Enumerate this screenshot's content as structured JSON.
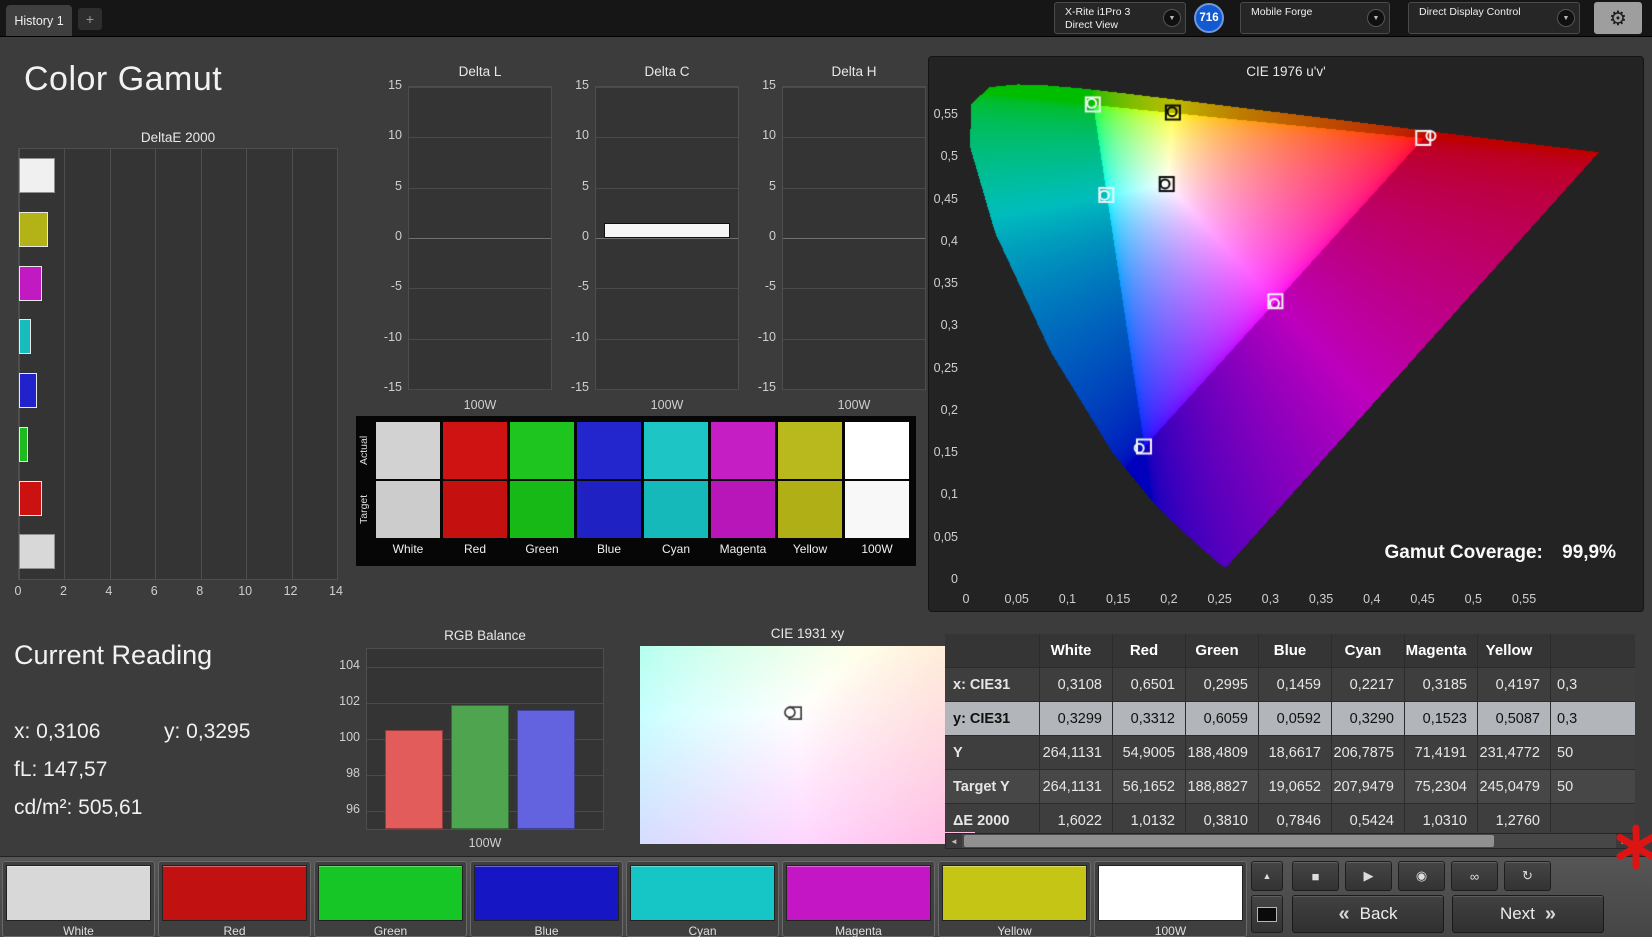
{
  "top_bar": {
    "tab": "History 1",
    "new_tab": "+",
    "meter_line1": "X-Rite i1Pro 3",
    "meter_line2": "Direct View",
    "meter_accent": "#3fd43f",
    "badge": "716",
    "source": "Mobile Forge",
    "source_accent": "#e8e81a",
    "display_control": "Direct Display Control",
    "display_accent": "#d6e81a",
    "gear_glyph": "⚙",
    "chevron_glyph": "▼"
  },
  "page": {
    "title": "Color Gamut"
  },
  "current_reading": {
    "title": "Current Reading",
    "line_x": "x: 0,3106",
    "line_y": "y: 0,3295",
    "line_fl": "fL: 147,57",
    "line_cd": "cd/m²: 505,61"
  },
  "gamut_coverage": {
    "label": "Gamut Coverage:",
    "value": "99,9%"
  },
  "swatch_grid": {
    "row_labels": [
      "Actual",
      "Target"
    ],
    "columns": [
      {
        "name": "White",
        "actual": "#d2d2d2",
        "target": "#cccccc"
      },
      {
        "name": "Red",
        "actual": "#cf1212",
        "target": "#c51010"
      },
      {
        "name": "Green",
        "actual": "#1ec51e",
        "target": "#16b916"
      },
      {
        "name": "Blue",
        "actual": "#2326cd",
        "target": "#1f21c2"
      },
      {
        "name": "Cyan",
        "actual": "#1ec5c5",
        "target": "#16b9b9"
      },
      {
        "name": "Magenta",
        "actual": "#c51ec5",
        "target": "#b916b9"
      },
      {
        "name": "Yellow",
        "actual": "#b9b91e",
        "target": "#b0b016"
      },
      {
        "name": "100W",
        "actual": "#ffffff",
        "target": "#f8f8f8"
      }
    ]
  },
  "table": {
    "headers": [
      "",
      "White",
      "Red",
      "Green",
      "Blue",
      "Cyan",
      "Magenta",
      "Yellow",
      ""
    ],
    "selected_index": 1,
    "rows": [
      {
        "label": "x: CIE31",
        "values": [
          "0,3108",
          "0,6501",
          "0,2995",
          "0,1459",
          "0,2217",
          "0,3185",
          "0,4197"
        ],
        "partial": "0,3"
      },
      {
        "label": "y: CIE31",
        "values": [
          "0,3299",
          "0,3312",
          "0,6059",
          "0,0592",
          "0,3290",
          "0,1523",
          "0,5087"
        ],
        "partial": "0,3"
      },
      {
        "label": "Y",
        "values": [
          "264,1131",
          "54,9005",
          "188,4809",
          "18,6617",
          "206,7875",
          "71,4191",
          "231,4772"
        ],
        "partial": "50"
      },
      {
        "label": "Target Y",
        "values": [
          "264,1131",
          "56,1652",
          "188,8827",
          "19,0652",
          "207,9479",
          "75,2304",
          "245,0479"
        ],
        "partial": "50"
      },
      {
        "label": "ΔE 2000",
        "values": [
          "1,6022",
          "1,0132",
          "0,3810",
          "0,7846",
          "0,5424",
          "1,0310",
          "1,2760"
        ],
        "partial": ""
      }
    ]
  },
  "scrollbar": {
    "left_arrow": "◄",
    "right_arrow": "►"
  },
  "bottom_bar": {
    "swatches": [
      {
        "label": "White",
        "color": "#d8d8d8"
      },
      {
        "label": "Red",
        "color": "#c21111"
      },
      {
        "label": "Green",
        "color": "#16c526"
      },
      {
        "label": "Blue",
        "color": "#1616c5"
      },
      {
        "label": "Cyan",
        "color": "#16c5c5"
      },
      {
        "label": "Magenta",
        "color": "#c516c5"
      },
      {
        "label": "Yellow",
        "color": "#c5c516"
      },
      {
        "label": "100W",
        "color": "#ffffff"
      }
    ],
    "up_glyph": "▲",
    "transport": [
      {
        "name": "stop-button",
        "icon": "stop-icon",
        "glyph": "■"
      },
      {
        "name": "play-button",
        "icon": "play-icon",
        "glyph": "▶"
      },
      {
        "name": "read-single-button",
        "icon": "read-single-icon",
        "glyph": "◉"
      },
      {
        "name": "link-button",
        "icon": "link-icon",
        "glyph": "∞"
      },
      {
        "name": "refresh-button",
        "icon": "refresh-icon",
        "glyph": "↻"
      }
    ],
    "back_chevron": "«",
    "back_label": "Back",
    "next_label": "Next",
    "next_chevron": "»"
  },
  "chart_data": [
    {
      "id": "deltae2000",
      "type": "bar",
      "orientation": "horizontal",
      "title": "DeltaE 2000",
      "categories": [
        "White",
        "Yellow",
        "Magenta",
        "Cyan",
        "Blue",
        "Green",
        "Red",
        "100W"
      ],
      "values": [
        1.6022,
        1.276,
        1.031,
        0.5424,
        0.7846,
        0.381,
        1.0132,
        1.6
      ],
      "bar_colors": [
        "#f0f0f0",
        "#b3b317",
        "#c21ac2",
        "#18bcbc",
        "#2222cc",
        "#1dbb1d",
        "#cc1111",
        "#d8d8d8"
      ],
      "xlim": [
        0,
        14
      ],
      "xticks": [
        0,
        2,
        4,
        6,
        8,
        10,
        12,
        14
      ]
    },
    {
      "id": "delta-l",
      "type": "bar",
      "title": "Delta L",
      "categories": [
        "100W"
      ],
      "values": [
        0
      ],
      "ylim": [
        -15,
        15
      ],
      "yticks": [
        15,
        10,
        5,
        0,
        -5,
        -10,
        -15
      ],
      "xlabel": "100W"
    },
    {
      "id": "delta-c",
      "type": "bar",
      "title": "Delta C",
      "categories": [
        "100W"
      ],
      "values": [
        1.5
      ],
      "ylim": [
        -15,
        15
      ],
      "yticks": [
        15,
        10,
        5,
        0,
        -5,
        -10,
        -15
      ],
      "xlabel": "100W"
    },
    {
      "id": "delta-h",
      "type": "bar",
      "title": "Delta H",
      "categories": [
        "100W"
      ],
      "values": [
        0
      ],
      "ylim": [
        -15,
        15
      ],
      "yticks": [
        15,
        10,
        5,
        0,
        -5,
        -10,
        -15
      ],
      "xlabel": "100W"
    },
    {
      "id": "cie1976",
      "type": "scatter",
      "title": "CIE 1976 u'v'",
      "xticks": [
        "0",
        "0,05",
        "0,1",
        "0,15",
        "0,2",
        "0,25",
        "0,3",
        "0,35",
        "0,4",
        "0,45",
        "0,5",
        "0,55"
      ],
      "yticks": [
        "0,55",
        "0,5",
        "0,45",
        "0,4",
        "0,35",
        "0,3",
        "0,25",
        "0,2",
        "0,15",
        "0,1",
        "0,05",
        "0"
      ],
      "axis_max": 0.55,
      "targets": [
        {
          "name": "Red",
          "x": 0.64,
          "y": 0.33
        },
        {
          "name": "Green",
          "x": 0.3,
          "y": 0.6
        },
        {
          "name": "Blue",
          "x": 0.15,
          "y": 0.06
        },
        {
          "name": "Cyan",
          "x": 0.2246,
          "y": 0.3287
        },
        {
          "name": "Magenta",
          "x": 0.3209,
          "y": 0.1542
        },
        {
          "name": "Yellow",
          "x": 0.4193,
          "y": 0.5053
        },
        {
          "name": "White",
          "x": 0.3127,
          "y": 0.329
        }
      ],
      "measured": [
        {
          "name": "Red",
          "x": 0.6501,
          "y": 0.3312
        },
        {
          "name": "Green",
          "x": 0.2995,
          "y": 0.6059
        },
        {
          "name": "Blue",
          "x": 0.1459,
          "y": 0.0592
        },
        {
          "name": "Cyan",
          "x": 0.2217,
          "y": 0.329
        },
        {
          "name": "Magenta",
          "x": 0.3185,
          "y": 0.1523
        },
        {
          "name": "Yellow",
          "x": 0.4197,
          "y": 0.5087
        },
        {
          "name": "White",
          "x": 0.3108,
          "y": 0.3299
        }
      ],
      "locus_xy": [
        [
          0.1741,
          0.005
        ],
        [
          0.1738,
          0.0049
        ],
        [
          0.1733,
          0.0048
        ],
        [
          0.1726,
          0.0048
        ],
        [
          0.1714,
          0.0051
        ],
        [
          0.1689,
          0.0069
        ],
        [
          0.1644,
          0.0109
        ],
        [
          0.1566,
          0.0177
        ],
        [
          0.144,
          0.0297
        ],
        [
          0.1241,
          0.0578
        ],
        [
          0.0913,
          0.1327
        ],
        [
          0.0454,
          0.295
        ],
        [
          0.0082,
          0.5384
        ],
        [
          0.0139,
          0.7502
        ],
        [
          0.0743,
          0.8338
        ],
        [
          0.1547,
          0.8059
        ],
        [
          0.2296,
          0.7543
        ],
        [
          0.3016,
          0.6923
        ],
        [
          0.3731,
          0.6245
        ],
        [
          0.4441,
          0.5547
        ],
        [
          0.5125,
          0.4866
        ],
        [
          0.5752,
          0.4242
        ],
        [
          0.627,
          0.3725
        ],
        [
          0.6658,
          0.334
        ],
        [
          0.6915,
          0.3083
        ],
        [
          0.7079,
          0.292
        ],
        [
          0.719,
          0.2809
        ],
        [
          0.726,
          0.274
        ],
        [
          0.73,
          0.27
        ],
        [
          0.732,
          0.268
        ],
        [
          0.7334,
          0.2666
        ],
        [
          0.7344,
          0.2656
        ],
        [
          0.7347,
          0.2653
        ]
      ]
    },
    {
      "id": "rgb-balance",
      "type": "bar",
      "title": "RGB Balance",
      "categories": [
        "Red",
        "Green",
        "Blue"
      ],
      "values": [
        100.5,
        101.9,
        101.6
      ],
      "bar_colors": [
        "#e25c5c",
        "#4fa54f",
        "#6363df"
      ],
      "ylim": [
        95,
        105
      ],
      "yticks": [
        104,
        102,
        100,
        98,
        96
      ],
      "xlabel": "100W"
    },
    {
      "id": "cie1931",
      "type": "scatter",
      "title": "CIE 1931 xy",
      "measured": {
        "x": 0.3106,
        "y": 0.3295
      },
      "target": {
        "x": 0.3127,
        "y": 0.329
      },
      "xrange": [
        0.25,
        0.385
      ],
      "yrange": [
        0.24,
        0.375
      ]
    }
  ]
}
